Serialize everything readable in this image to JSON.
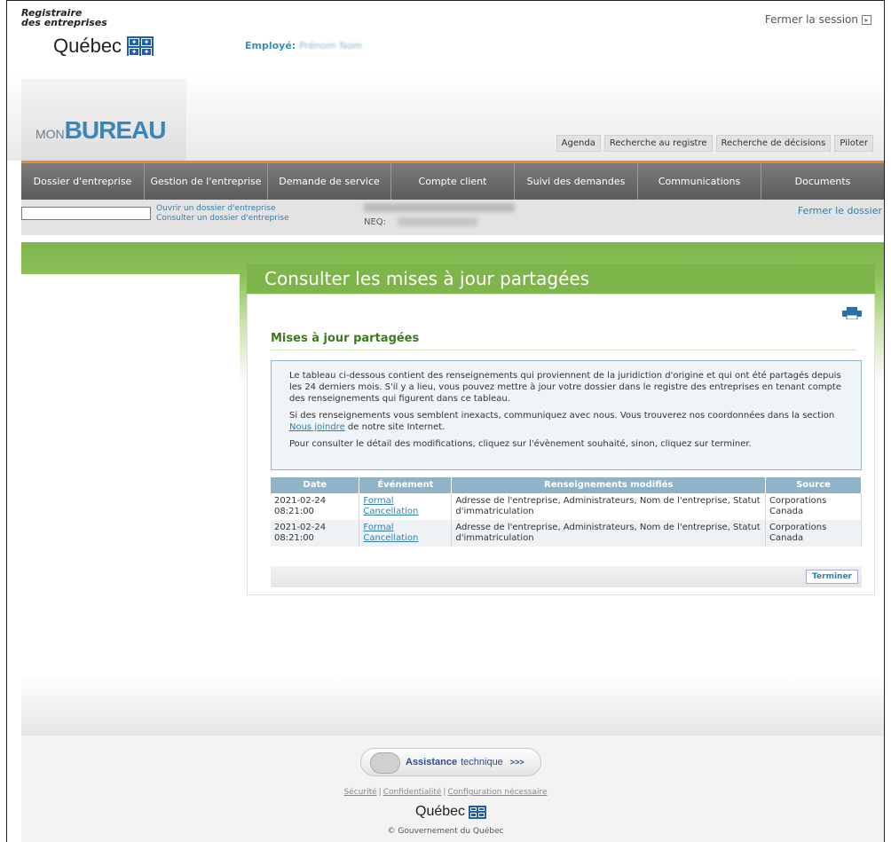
{
  "header": {
    "registrar_line1": "Registraire",
    "registrar_line2": "des entreprises",
    "quebec": "Québec",
    "employee_label": "Employé:",
    "employee_name": "Prénom Nom",
    "logout": "Fermer la session",
    "mon": "MON",
    "bureau": "BUREAU"
  },
  "toplinks": [
    "Agenda",
    "Recherche au registre",
    "Recherche de décisions",
    "Piloter"
  ],
  "nav": [
    "Dossier d'entreprise",
    "Gestion de l'entreprise",
    "Demande de service",
    "Compte client",
    "Suivi des demandes",
    "Communications",
    "Documents"
  ],
  "context": {
    "open_link": "Ouvrir un dossier d'entreprise",
    "consult_link": "Consulter un dossier d'entreprise",
    "neq_label": "NEQ:",
    "close_file": "Fermer le dossier"
  },
  "page": {
    "title": "Consulter les mises à jour partagées",
    "section": "Mises à jour partagées",
    "info_p1": "Le tableau ci-dessous contient des renseignements qui proviennent de la juridiction d'origine et qui ont été partagés depuis les 24 derniers mois. S'il y a lieu, vous pouvez mettre à jour votre dossier dans le registre des entreprises en tenant compte des renseignements qui figurent dans ce tableau.",
    "info_p2_a": "Si des renseignements vous semblent inexacts, communiquez avec nous. Vous trouverez nos coordonnées dans la section",
    "info_p2_link": "Nous joindre",
    "info_p2_b": "de notre site Internet.",
    "info_p3": "Pour consulter le détail des modifications, cliquez sur l'évènement souhaité, sinon, cliquez sur terminer.",
    "finish": "Terminer"
  },
  "table": {
    "headers": [
      "Date",
      "Événement",
      "Renseignements modifiés",
      "Source"
    ],
    "rows": [
      {
        "date": "2021-02-24 08:21:00",
        "event": "Formal Cancellation",
        "info": "Adresse de l'entreprise, Administrateurs, Nom de l'entreprise, Statut d'immatriculation",
        "source": "Corporations Canada"
      },
      {
        "date": "2021-02-24 08:21:00",
        "event": "Formal Cancellation",
        "info": "Adresse de l'entreprise, Administrateurs, Nom de l'entreprise, Statut d'immatriculation",
        "source": "Corporations Canada"
      }
    ]
  },
  "footer": {
    "assist_bold": "Assistance",
    "assist_rest": "technique",
    "assist_arrow": ">>>",
    "links": [
      "Sécurité",
      "Confidentialité",
      "Configuration nécessaire"
    ],
    "quebec": "Québec",
    "copyright": "© Gouvernement du Québec"
  }
}
